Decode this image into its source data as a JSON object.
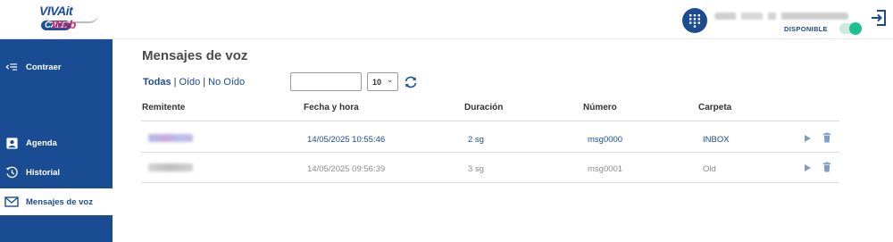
{
  "header": {
    "logo_top": "VIVAit",
    "logo_call": "CALL",
    "logo_bottom": "Web",
    "status_label": "DISPONIBLE"
  },
  "sidebar": {
    "collapse_label": "Contraer",
    "items": [
      {
        "label": "Agenda",
        "icon": "contact-book-icon"
      },
      {
        "label": "Historial",
        "icon": "history-icon"
      },
      {
        "label": "Mensajes de voz",
        "icon": "mail-icon",
        "active": true
      }
    ]
  },
  "main": {
    "title": "Mensajes de voz",
    "filters": [
      {
        "label": "Todas",
        "active": true
      },
      {
        "label": "Oído"
      },
      {
        "label": "No Oído"
      }
    ],
    "search_value": "",
    "page_size": "10",
    "columns": [
      "Remitente",
      "Fecha y hora",
      "Duración",
      "Número",
      "Carpeta"
    ],
    "rows": [
      {
        "datetime": "14/05/2025 10:55:46",
        "duration": "2 sg",
        "number": "msg0000",
        "folder": "INBOX",
        "unread": true
      },
      {
        "datetime": "14/05/2025 09:56:39",
        "duration": "3 sg",
        "number": "msg0001",
        "folder": "Old",
        "unread": false
      }
    ]
  },
  "colors": {
    "brand_blue": "#1a4c94",
    "brand_pink": "#d6246e",
    "status_green": "#1fbf94"
  }
}
